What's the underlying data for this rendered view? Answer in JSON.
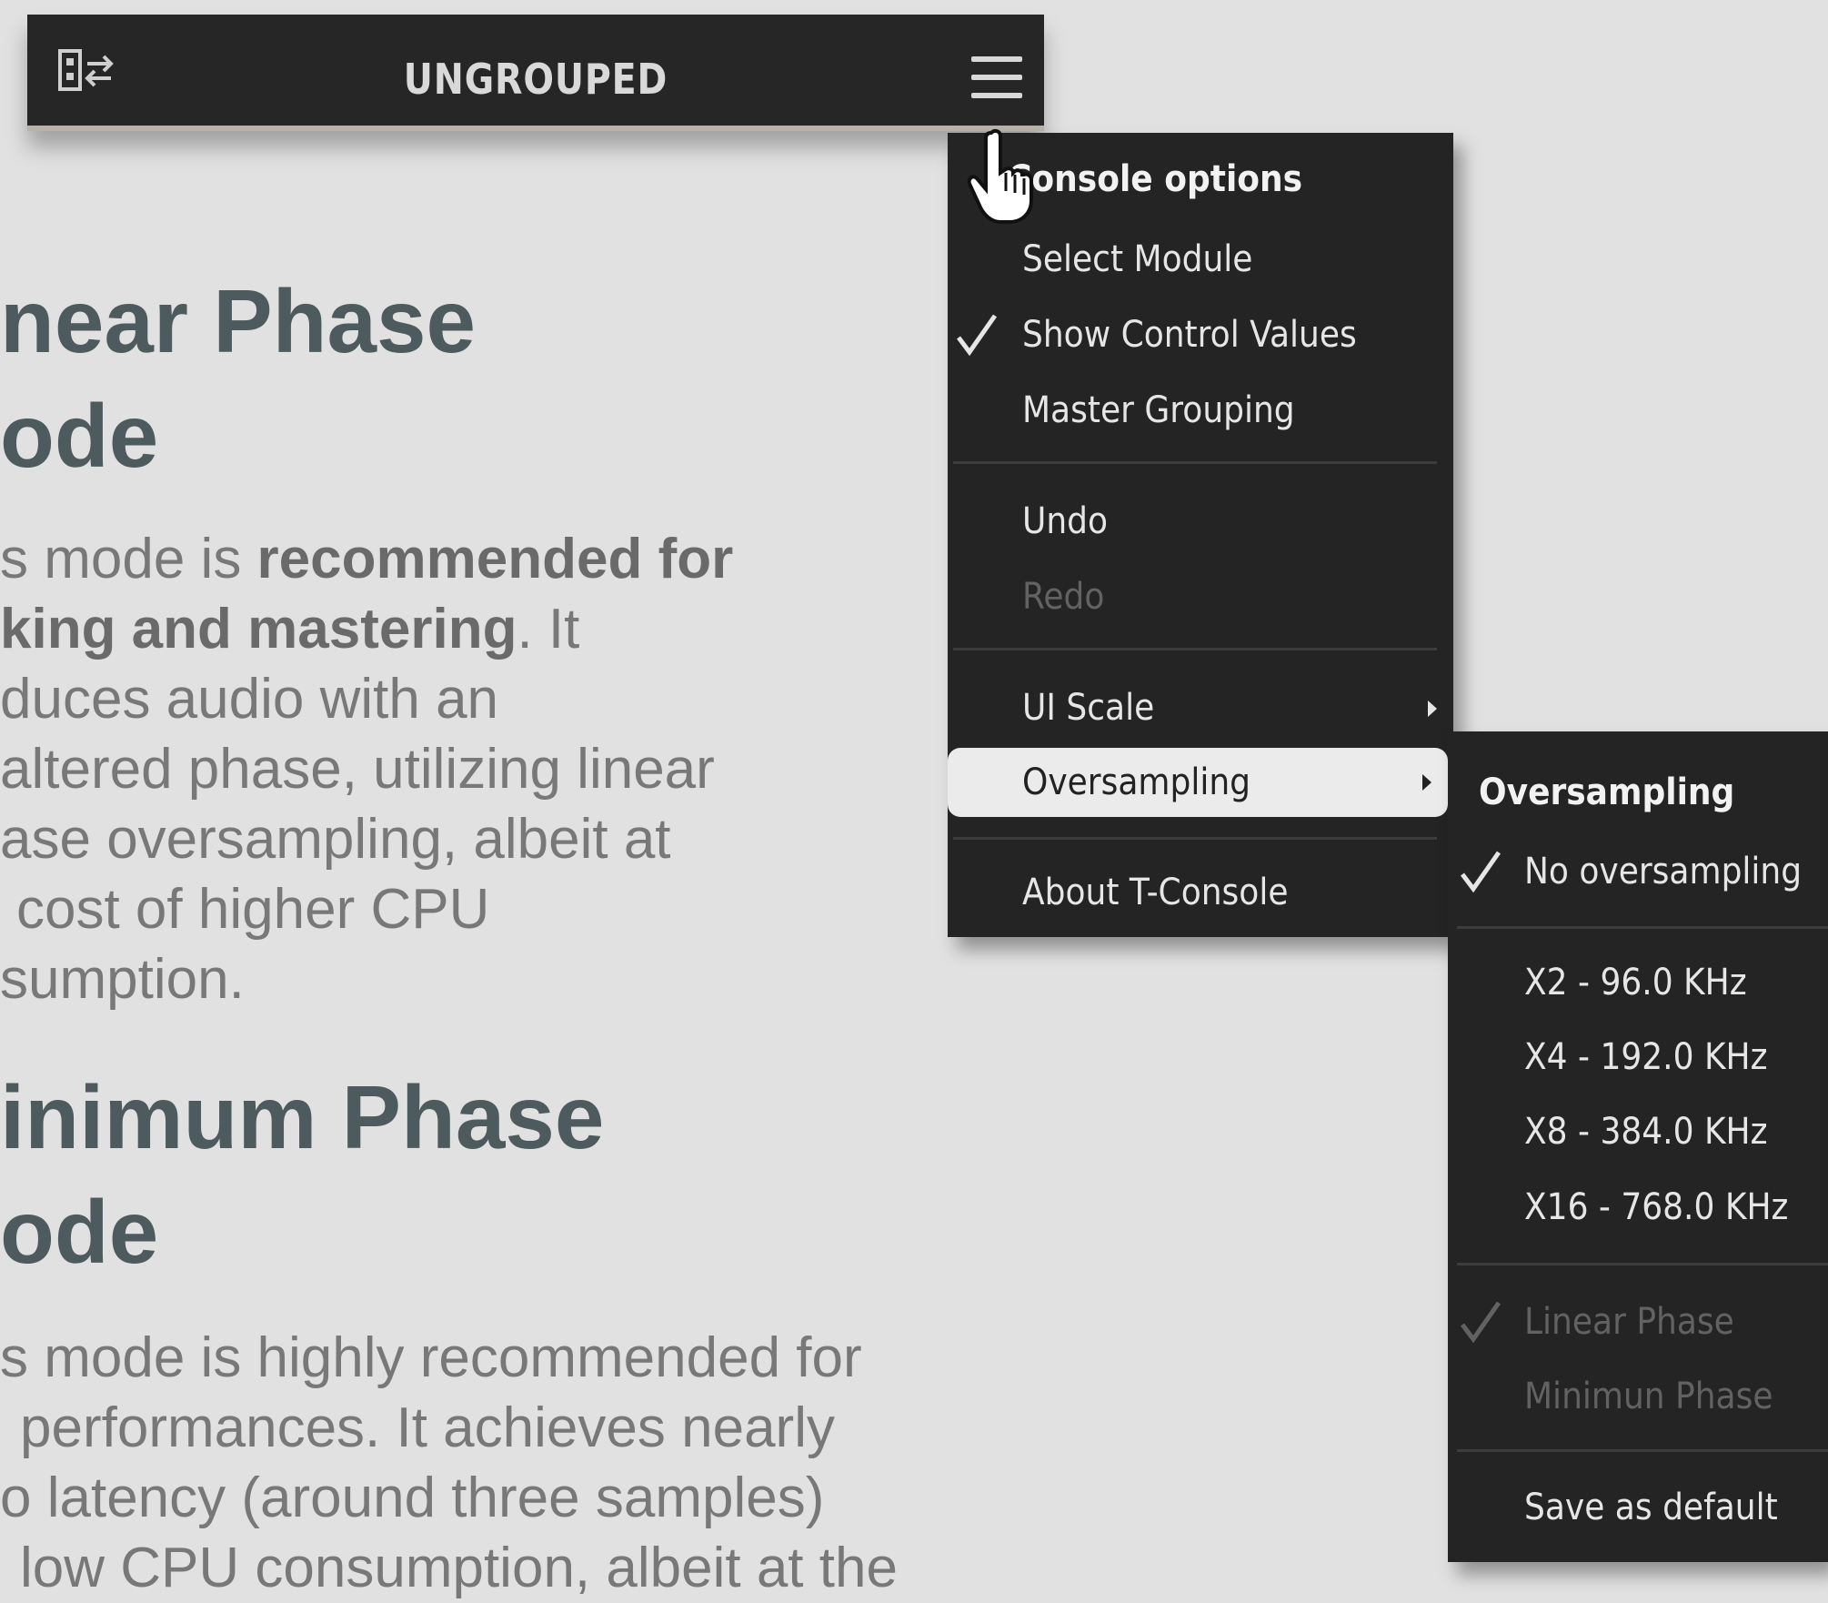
{
  "topbar": {
    "title": "UNGROUPED",
    "left_icon": "group-layout-icon",
    "right_icon": "hamburger-menu-icon"
  },
  "doc": {
    "section1": {
      "heading_line1": "near Phase",
      "heading_line2": "ode",
      "para": {
        "l1_pre": "s mode is ",
        "l1_bold": "recommended for",
        "l2_bold": "king and mastering",
        "l2_post": ". It",
        "l3": "duces audio with an",
        "l4": "altered phase, utilizing linear",
        "l5": "ase oversampling, albeit at",
        "l6": "cost of higher CPU",
        "l7": "sumption."
      }
    },
    "section2": {
      "heading_line1": "inimum Phase",
      "heading_line2": "ode",
      "para": {
        "l1": "s mode is highly recommended for",
        "l2": "performances. It achieves nearly",
        "l3": "o latency (around three samples)",
        "l4": "low CPU consumption, albeit at the"
      }
    }
  },
  "main_menu": {
    "header": "Console options",
    "items": [
      {
        "label": "Select Module"
      },
      {
        "label": "Show Control Values",
        "checked": true
      },
      {
        "label": "Master Grouping"
      },
      {
        "label": "Undo"
      },
      {
        "label": "Redo",
        "disabled": true
      },
      {
        "label": "UI Scale",
        "submenu": true
      },
      {
        "label": "Oversampling",
        "submenu": true,
        "highlighted": true
      },
      {
        "label": "About T-Console"
      }
    ]
  },
  "oversampling_menu": {
    "header": "Oversampling",
    "items": [
      {
        "label": "No oversampling",
        "checked": true
      },
      {
        "label": "X2 - 96.0 KHz"
      },
      {
        "label": "X4 - 192.0 KHz"
      },
      {
        "label": "X8 - 384.0 KHz"
      },
      {
        "label": "X16 - 768.0 KHz"
      },
      {
        "label": "Linear Phase",
        "checked": true,
        "disabled": true
      },
      {
        "label": "Minimun Phase",
        "disabled": true
      },
      {
        "label": "Save as default"
      }
    ]
  },
  "colors": {
    "menu_bg": "#242424",
    "menu_text": "#e6e6e6",
    "menu_disabled": "#626262",
    "highlight_bg": "#ebebeb",
    "heading": "#4d5a5e",
    "body_text": "#787878",
    "page_bg": "#e1e1e1"
  }
}
